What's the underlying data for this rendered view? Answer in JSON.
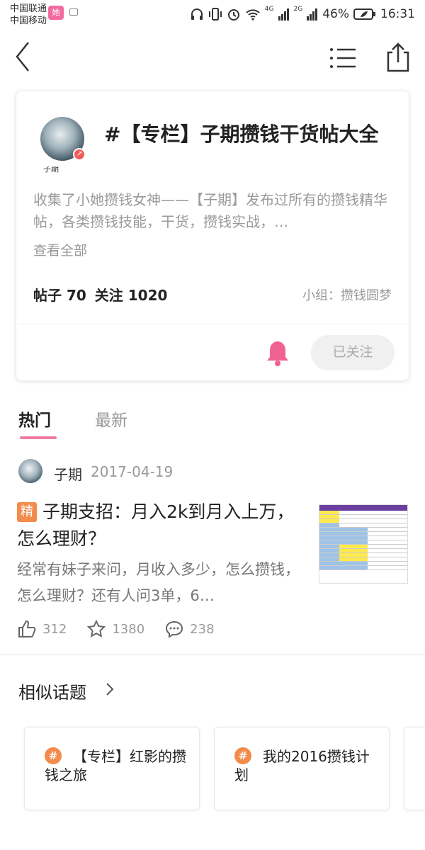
{
  "status_bar": {
    "carrier1": "中国联通",
    "carrier2": "中国移动",
    "app_badge": "她",
    "network1": "4G",
    "network2": "2G",
    "battery": "46%",
    "time": "16:31"
  },
  "card": {
    "title": "#【专栏】子期攒钱干货帖大全",
    "avatar_name": "子期",
    "description": "收集了小她攒钱女神——【子期】发布过所有的攒钱精华帖，各类攒钱技能，干货，攒钱实战，…",
    "more": "查看全部",
    "posts_label": "帖子 70",
    "follows_label": "关注 1020",
    "group": "小组：攒钱圆梦",
    "follow_button": "已关注"
  },
  "tabs": [
    {
      "label": "热门",
      "active": true
    },
    {
      "label": "最新",
      "active": false
    }
  ],
  "post": {
    "author": "子期",
    "date": "2017-04-19",
    "badge": "精",
    "title": "子期支招：月入2k到月入上万，怎么理财？",
    "excerpt": "经常有妹子来问，月收入多少，怎么攒钱，怎么理财？还有人问3单，6…",
    "likes": "312",
    "favorites": "1380",
    "comments": "238"
  },
  "similar": {
    "title": "相似话题",
    "topics": [
      {
        "label": "【专栏】红影的攒钱之旅"
      },
      {
        "label": "我的2016攒钱计划"
      }
    ]
  },
  "colors": {
    "accent_pink": "#ef7aa2",
    "bell_pink": "#f06292",
    "badge_orange": "#f28b4b"
  }
}
